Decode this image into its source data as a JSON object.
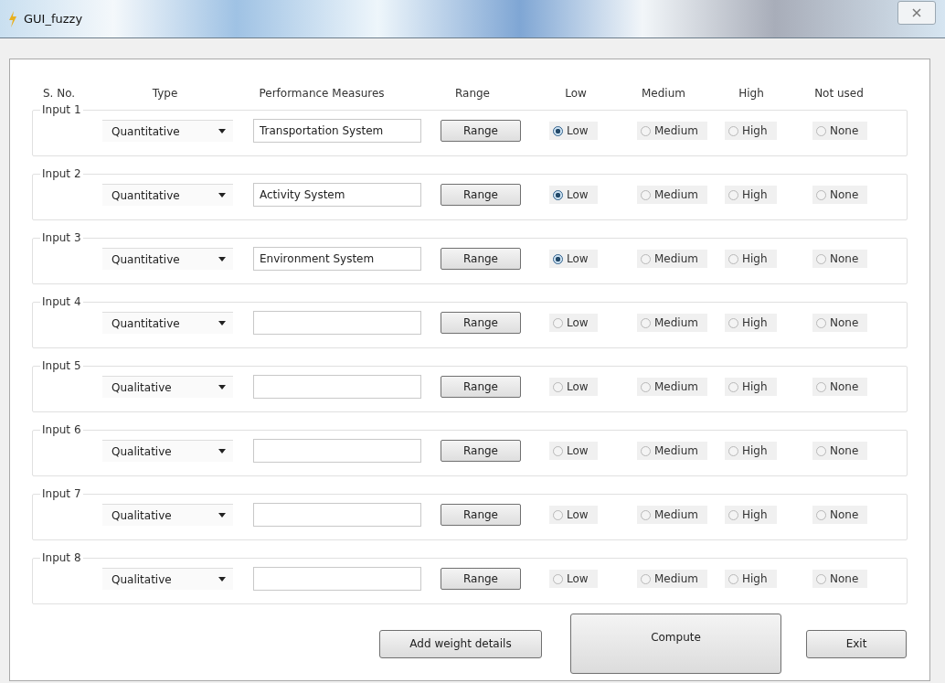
{
  "window": {
    "title": "GUI_fuzzy"
  },
  "headers": [
    "S. No.",
    "Type",
    "Performance Measures",
    "Range",
    "Low",
    "Medium",
    "High",
    "Not used"
  ],
  "inputs": [
    {
      "label": "Input 1",
      "type": "Quantitative",
      "measure": "Transportation System",
      "range_button": "Range",
      "options": [
        {
          "label": "Low",
          "selected": true
        },
        {
          "label": "Medium",
          "selected": false
        },
        {
          "label": "High",
          "selected": false
        },
        {
          "label": "None",
          "selected": false
        }
      ]
    },
    {
      "label": "Input 2",
      "type": "Quantitative",
      "measure": "Activity System",
      "range_button": "Range",
      "options": [
        {
          "label": "Low",
          "selected": true
        },
        {
          "label": "Medium",
          "selected": false
        },
        {
          "label": "High",
          "selected": false
        },
        {
          "label": "None",
          "selected": false
        }
      ]
    },
    {
      "label": "Input 3",
      "type": "Quantitative",
      "measure": "Environment System",
      "range_button": "Range",
      "options": [
        {
          "label": "Low",
          "selected": true
        },
        {
          "label": "Medium",
          "selected": false
        },
        {
          "label": "High",
          "selected": false
        },
        {
          "label": "None",
          "selected": false
        }
      ]
    },
    {
      "label": "Input 4",
      "type": "Quantitative",
      "range_button": "Range",
      "options": [
        {
          "label": "Low",
          "selected": false
        },
        {
          "label": "Medium",
          "selected": false
        },
        {
          "label": "High",
          "selected": false
        },
        {
          "label": "None",
          "selected": false
        }
      ]
    },
    {
      "label": "Input 5",
      "type": "Qualitative",
      "range_button": "Range",
      "options": [
        {
          "label": "Low",
          "selected": false
        },
        {
          "label": "Medium",
          "selected": false
        },
        {
          "label": "High",
          "selected": false
        },
        {
          "label": "None",
          "selected": false
        }
      ]
    },
    {
      "label": "Input 6",
      "type": "Qualitative",
      "range_button": "Range",
      "options": [
        {
          "label": "Low",
          "selected": false
        },
        {
          "label": "Medium",
          "selected": false
        },
        {
          "label": "High",
          "selected": false
        },
        {
          "label": "None",
          "selected": false
        }
      ]
    },
    {
      "label": "Input 7",
      "type": "Qualitative",
      "range_button": "Range",
      "options": [
        {
          "label": "Low",
          "selected": false
        },
        {
          "label": "Medium",
          "selected": false
        },
        {
          "label": "High",
          "selected": false
        },
        {
          "label": "None",
          "selected": false
        }
      ]
    },
    {
      "label": "Input 8",
      "type": "Qualitative",
      "range_button": "Range",
      "options": [
        {
          "label": "Low",
          "selected": false
        },
        {
          "label": "Medium",
          "selected": false
        },
        {
          "label": "High",
          "selected": false
        },
        {
          "label": "None",
          "selected": false
        }
      ]
    }
  ],
  "buttons": [
    {
      "label": "Add weight details",
      "kind": "normal"
    },
    {
      "label": "Compute",
      "kind": "large"
    },
    {
      "label": "Exit",
      "kind": "normal"
    }
  ]
}
